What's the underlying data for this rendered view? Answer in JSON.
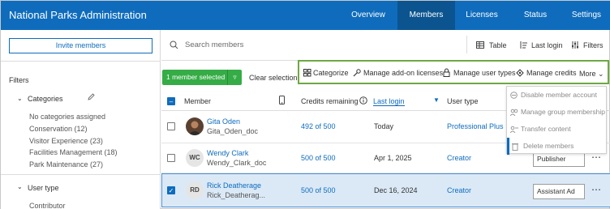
{
  "header": {
    "app_title": "National Parks Administration",
    "nav": [
      "Overview",
      "Members",
      "Licenses",
      "Status",
      "Settings"
    ],
    "active_nav": "Members"
  },
  "sidebar": {
    "invite_label": "Invite members",
    "filters_label": "Filters",
    "categories": {
      "label": "Categories",
      "items": [
        "No categories assigned",
        "Conservation  (12)",
        "Visitor Experience  (23)",
        "Facilities Management  (18)",
        "Park Maintenance  (27)"
      ]
    },
    "user_type": {
      "label": "User type",
      "items": [
        "Contributor"
      ]
    }
  },
  "toolbar": {
    "search_placeholder": "Search members",
    "table_label": "Table",
    "sort_label": "Last login",
    "filters_label": "Filters"
  },
  "selection": {
    "selected_label": "1 member selected",
    "clear_label": "Clear selection"
  },
  "actions": {
    "categorize": "Categorize",
    "manage_addon": "Manage add-on licenses",
    "manage_user_types": "Manage user types",
    "manage_credits": "Manage credits",
    "more": "More"
  },
  "more_menu": [
    "Disable member account",
    "Manage group membership",
    "Transfer content",
    "Delete members"
  ],
  "table": {
    "headers": {
      "member": "Member",
      "credits": "Credits remaining",
      "last_login": "Last login",
      "user_type": "User type"
    },
    "rows": [
      {
        "name": "Gita Oden",
        "username": "Gita_Oden_doc",
        "initials": "",
        "credits": "492 of 500",
        "last_login": "Today",
        "user_type": "Professional Plus",
        "role": "",
        "selected": false
      },
      {
        "name": "Wendy Clark",
        "username": "Wendy_Clark_doc",
        "initials": "WC",
        "credits": "500 of 500",
        "last_login": "Apr 1, 2025",
        "user_type": "Creator",
        "role": "Publisher",
        "selected": false
      },
      {
        "name": "Rick Deatherage",
        "username": "Rick_Deatherag...",
        "initials": "RD",
        "credits": "500 of 500",
        "last_login": "Dec 16, 2024",
        "user_type": "Creator",
        "role": "Assistant Ad",
        "selected": true
      }
    ]
  },
  "colors": {
    "header_bg": "#0f6cbd",
    "active_nav_bg": "#0b548f",
    "selected_btn": "#35ac46",
    "highlight_border": "#6ea843",
    "selected_row_bg": "#dbe9f7"
  }
}
